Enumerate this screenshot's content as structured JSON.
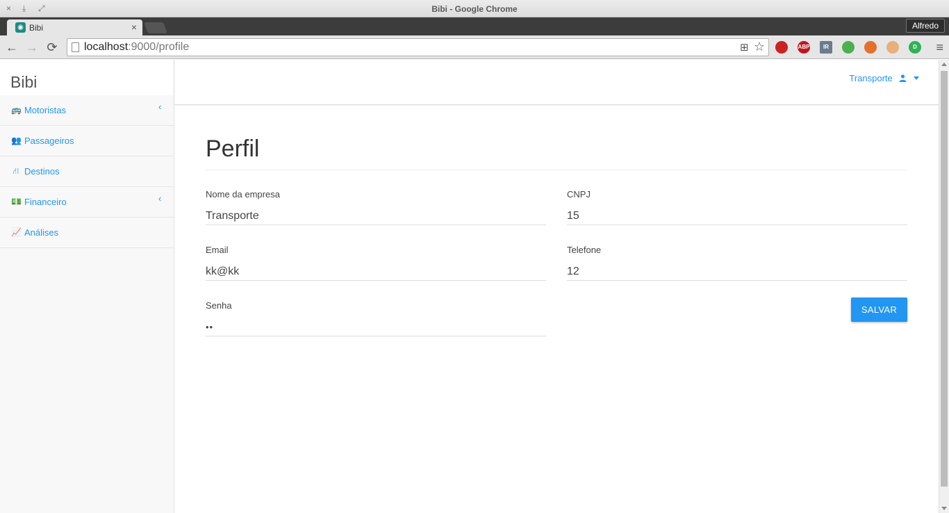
{
  "window": {
    "title": "Bibi - Google Chrome",
    "close_glyph": "×",
    "minimize_glyph": "⤓",
    "maximize_glyph": "⤢"
  },
  "browser": {
    "tab_title": "Bibi",
    "tab_close_glyph": "×",
    "profile_name": "Alfredo",
    "url_host": "localhost",
    "url_path": ":9000/profile",
    "back_glyph": "←",
    "forward_glyph": "→",
    "reload_glyph": "⟳",
    "menu_glyph": "≡",
    "translate_glyph": "⊞",
    "star_glyph": "☆",
    "extensions": [
      {
        "name": "privacy-extension-icon",
        "label": "",
        "color": "#cc2222"
      },
      {
        "name": "adblock-plus-icon",
        "label": "ABP",
        "color": "#c0161e"
      },
      {
        "name": "ir-extension-icon",
        "label": "IR",
        "color": "#6b7c8e"
      },
      {
        "name": "speech-bubble-extension-icon",
        "label": "",
        "color": "#4caf50"
      },
      {
        "name": "color-picker-extension-icon",
        "label": "",
        "color": "#e5702a"
      },
      {
        "name": "character-extension-icon",
        "label": "",
        "color": "#e8b07a"
      },
      {
        "name": "d-extension-icon",
        "label": "D",
        "color": "#2fb157"
      }
    ]
  },
  "app": {
    "brand": "Bibi",
    "accent_color": "#2196f3",
    "user_menu_label": "Transporte",
    "sidebar": [
      {
        "id": "motoristas",
        "label": "Motoristas",
        "icon": "bus-icon",
        "glyph": "🚌",
        "has_submenu": true
      },
      {
        "id": "passageiros",
        "label": "Passageiros",
        "icon": "users-icon",
        "glyph": "👥",
        "has_submenu": false
      },
      {
        "id": "destinos",
        "label": "Destinos",
        "icon": "road-icon",
        "glyph": "⛙",
        "has_submenu": false
      },
      {
        "id": "financeiro",
        "label": "Financeiro",
        "icon": "money-icon",
        "glyph": "💵",
        "has_submenu": true
      },
      {
        "id": "analises",
        "label": "Análises",
        "icon": "line-chart-icon",
        "glyph": "📈",
        "has_submenu": false
      }
    ],
    "chevron_glyph": "‹"
  },
  "profile": {
    "title": "Perfil",
    "fields": {
      "company_name": {
        "label": "Nome da empresa",
        "value": "Transporte"
      },
      "cnpj": {
        "label": "CNPJ",
        "value": "15"
      },
      "email": {
        "label": "Email",
        "value": "kk@kk"
      },
      "phone": {
        "label": "Telefone",
        "value": "12"
      },
      "password": {
        "label": "Senha",
        "value": "kk"
      }
    },
    "save_label": "SALVAR"
  }
}
